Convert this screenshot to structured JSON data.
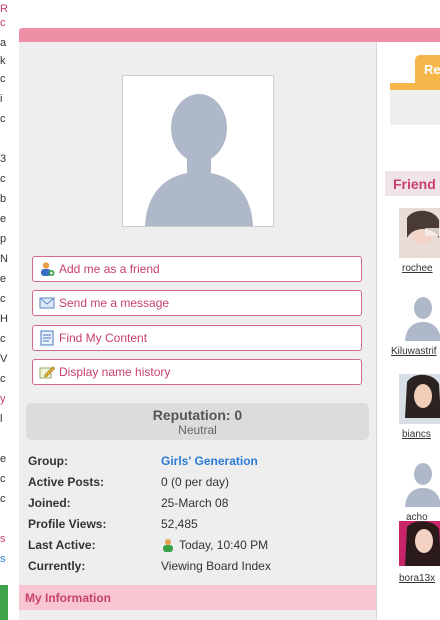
{
  "left_strip_chars": [
    "R",
    "c",
    "a",
    "k",
    "c",
    "i",
    "c",
    "3",
    "c",
    "b",
    "e",
    "p",
    "N",
    "e",
    "c",
    "H",
    "c",
    "V",
    "c",
    "y",
    "l",
    "e",
    "c",
    "c",
    "s",
    "s"
  ],
  "profile": {
    "buttons": [
      {
        "label": "Add me as a friend",
        "icon": "add-friend-icon"
      },
      {
        "label": "Send me a message",
        "icon": "envelope-icon"
      },
      {
        "label": "Find My Content",
        "icon": "document-icon"
      },
      {
        "label": "Display name history",
        "icon": "pencil-icon"
      }
    ],
    "reputation": {
      "title": "Reputation: 0",
      "status": "Neutral"
    },
    "info": [
      {
        "key": "Group:",
        "value": "Girls' Generation"
      },
      {
        "key": "Active Posts:",
        "value": "0 (0 per day)"
      },
      {
        "key": "Joined:",
        "value": "25-March 08"
      },
      {
        "key": "Profile Views:",
        "value": "52,485"
      },
      {
        "key": "Last Active:",
        "value": "Today, 10:40 PM"
      },
      {
        "key": "Currently:",
        "value": "Viewing Board Index"
      }
    ],
    "my_information": "My Information"
  },
  "right": {
    "tab_label": "Re",
    "friends_title": "Friend",
    "friends": [
      {
        "name": "rochee"
      },
      {
        "name": "Kiluwastrif"
      },
      {
        "name": "biancs"
      },
      {
        "name": "acho"
      },
      {
        "name": "bora13x"
      }
    ]
  },
  "colors": {
    "accent": "#c8416a",
    "topbar": "#ef8fa7",
    "tab": "#f6b74a",
    "link": "#2a7bd3"
  }
}
